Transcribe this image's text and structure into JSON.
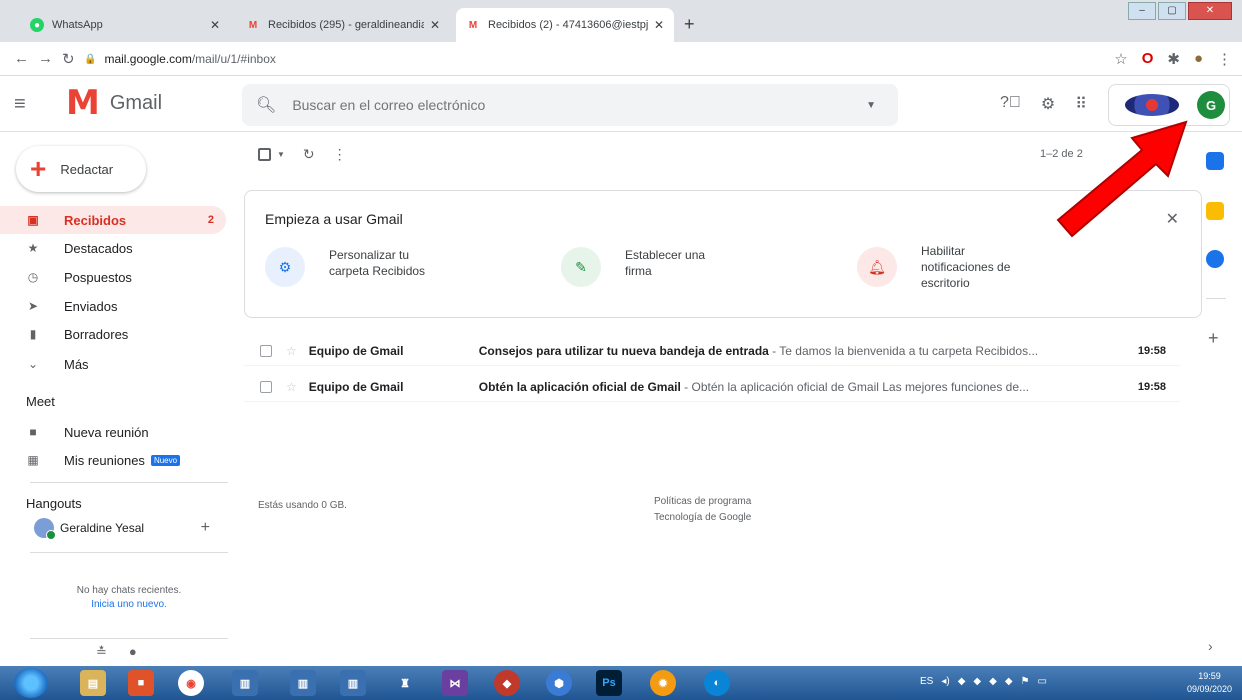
{
  "browser": {
    "tabs": [
      {
        "label": "WhatsApp",
        "favicon": "whatsapp-icon",
        "active": false
      },
      {
        "label": "Recibidos (295) - geraldineandia...",
        "favicon": "gmail-icon",
        "active": false
      },
      {
        "label": "Recibidos (2) - 47413606@iestpj...",
        "favicon": "gmail-icon",
        "active": true
      }
    ],
    "url_host": "mail.google.com",
    "url_path": "/mail/u/1/#inbox"
  },
  "header": {
    "product_name": "Gmail",
    "search_placeholder": "Buscar en el correo electrónico",
    "avatar_initial": "G"
  },
  "sidebar": {
    "compose_label": "Redactar",
    "items": [
      {
        "label": "Recibidos",
        "icon": "inbox-icon",
        "count": "2",
        "active": true
      },
      {
        "label": "Destacados",
        "icon": "star-icon",
        "count": "",
        "active": false
      },
      {
        "label": "Pospuestos",
        "icon": "clock-icon",
        "count": "",
        "active": false
      },
      {
        "label": "Enviados",
        "icon": "send-icon",
        "count": "",
        "active": false
      },
      {
        "label": "Borradores",
        "icon": "draft-icon",
        "count": "",
        "active": false
      },
      {
        "label": "Más",
        "icon": "chevron-down-icon",
        "count": "",
        "active": false
      }
    ],
    "meet": {
      "heading": "Meet",
      "new_meeting": "Nueva reunión",
      "my_meetings": "Mis reuniones",
      "new_badge": "Nuevo"
    },
    "hangouts": {
      "heading": "Hangouts",
      "user": "Geraldine Yesal",
      "no_chats": "No hay chats recientes.",
      "start_new": "Inicia uno nuevo."
    }
  },
  "toolbar": {
    "pager": "1–2 de 2"
  },
  "welcome": {
    "title": "Empieza a usar Gmail",
    "tasks": [
      {
        "line1": "Personalizar tu",
        "line2": "carpeta Recibidos",
        "line3": "",
        "color": "#1a73e8",
        "bg": "#e8f0fe"
      },
      {
        "line1": "Establecer una",
        "line2": "firma",
        "line3": "",
        "color": "#1e8e3e",
        "bg": "#e6f4ea"
      },
      {
        "line1": "Habilitar",
        "line2": "notificaciones de",
        "line3": "escritorio",
        "color": "#d93025",
        "bg": "#fce8e6"
      }
    ]
  },
  "emails": [
    {
      "sender": "Equipo de Gmail",
      "subject": "Consejos para utilizar tu nueva bandeja de entrada",
      "snippet": " - Te damos la bienvenida a tu carpeta Recibidos...",
      "time": "19:58"
    },
    {
      "sender": "Equipo de Gmail",
      "subject": "Obtén la aplicación oficial de Gmail",
      "snippet": " - Obtén la aplicación oficial de Gmail Las mejores funciones de...",
      "time": "19:58"
    }
  ],
  "footer": {
    "storage": "Estás usando 0 GB.",
    "policies": "Políticas de programa",
    "tech": "Tecnología de Google"
  },
  "taskbar": {
    "lang": "ES",
    "time": "19:59",
    "date": "09/09/2020"
  },
  "colors": {
    "accent_red": "#d93025",
    "arrow_red": "#ff0000"
  }
}
